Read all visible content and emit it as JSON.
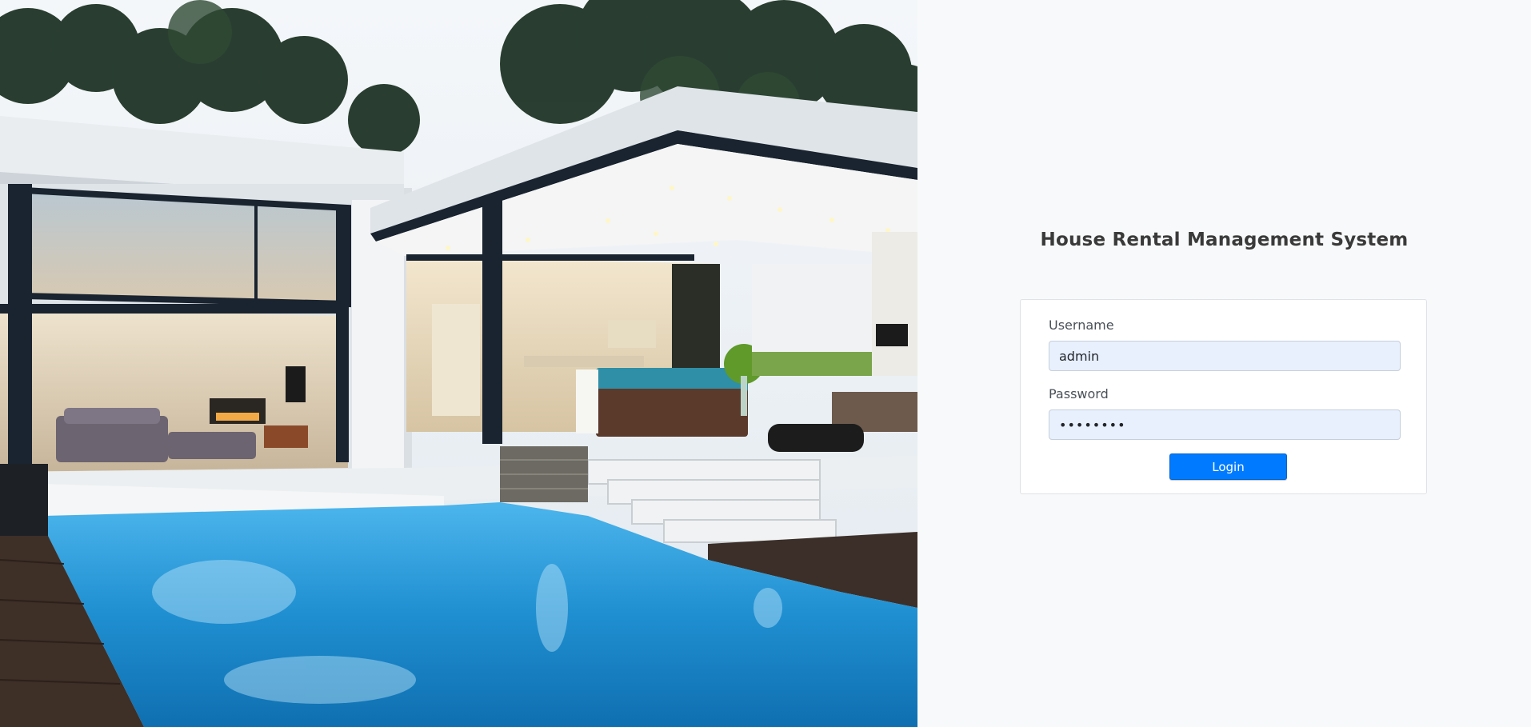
{
  "app": {
    "title": "House Rental Management System"
  },
  "login": {
    "username_label": "Username",
    "username_value": "admin",
    "password_label": "Password",
    "password_value": "admin123",
    "button_label": "Login"
  },
  "colors": {
    "page_background": "#f8f9fa",
    "card_background": "#ffffff",
    "input_fill": "#e8f0fe",
    "button_primary": "#007bff",
    "pool_water": "#1f8fd1"
  },
  "hero_image": {
    "icon": "house-with-pool-photo"
  }
}
